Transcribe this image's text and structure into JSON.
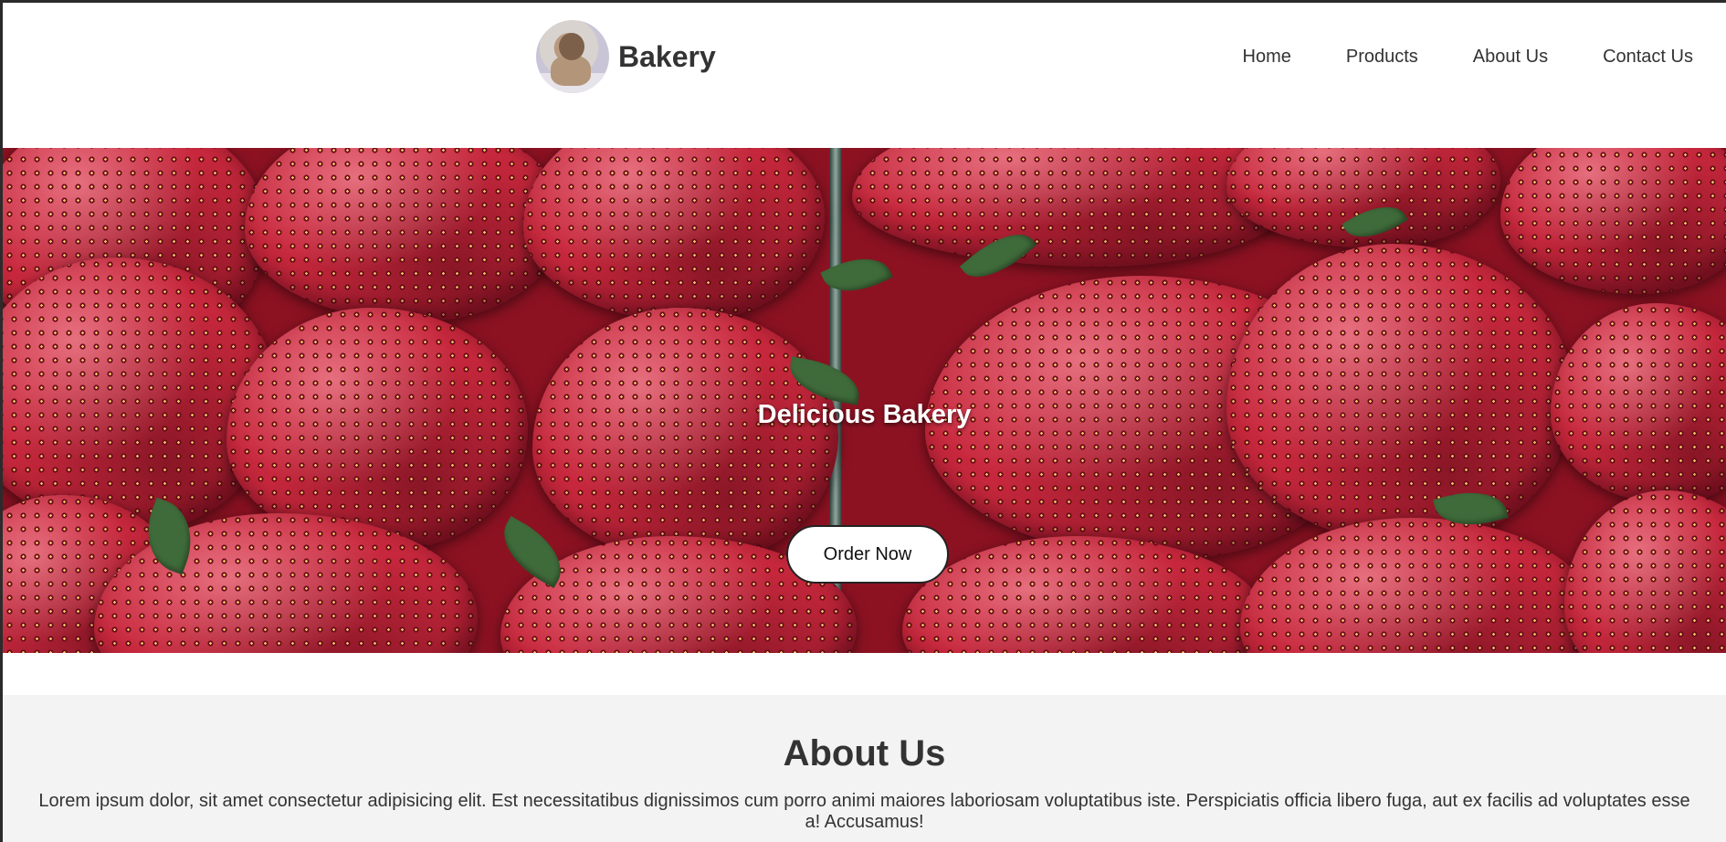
{
  "brand": {
    "name": "Bakery",
    "logo_icon": "puppy-avatar-icon"
  },
  "nav": {
    "items": [
      {
        "label": "Home"
      },
      {
        "label": "Products"
      },
      {
        "label": "About Us"
      },
      {
        "label": "Contact Us"
      }
    ]
  },
  "hero": {
    "title": "Delicious Bakery",
    "button_label": "Order Now",
    "background": "strawberries-photo"
  },
  "about": {
    "heading": "About Us",
    "text": "Lorem ipsum dolor, sit amet consectetur adipisicing elit. Est necessitatibus dignissimos cum porro animi maiores laboriosam voluptatibus iste. Perspiciatis officia libero fuga, aut ex facilis ad voluptates esse a! Accusamus!"
  },
  "colors": {
    "text": "#333333",
    "header_bg": "#ffffff",
    "about_bg": "#f3f3f3",
    "hero_overlay_text": "#ffffff",
    "button_bg": "#ffffff"
  }
}
